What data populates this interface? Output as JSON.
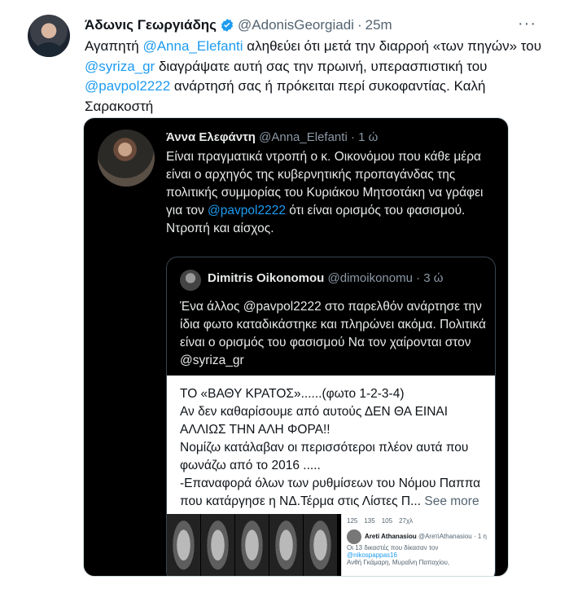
{
  "tweet": {
    "author_name": "Άδωνις Γεωργιάδης",
    "handle": "@AdonisGeorgiadi",
    "separator": "·",
    "time": "25m",
    "more_icon": "more-dots-icon",
    "verified_icon": "verified-badge-icon",
    "body": {
      "t1": "Αγαπητή ",
      "m1": "@Anna_Elefanti",
      "t2": " αληθεύει ότι μετά την διαρροή «των πηγών» του ",
      "m2": "@syriza_gr",
      "t3": " διαγράψατε αυτή σας την πρωινή, υπερασπιστική του ",
      "m3": "@pavpol2222",
      "t4": " ανάρτησή σας ή πρόκειται περί συκοφαντίας. Καλή Σαρακοστή"
    }
  },
  "embed": {
    "author_name": "Άννα Ελεφάντη",
    "handle": "@Anna_Elefanti",
    "separator": "·",
    "time": "1 ώ",
    "text1": "Είναι πραγματικά ντροπή ο κ. Οικονόμου που κάθε μέρα είναι ο αρχηγός της κυβερνητικής προπαγάνδας της πολιτικής συμμορίας του Κυριάκου Μητσοτάκη να γράφει για τον ",
    "mention": "@pavpol2222",
    "text2": " ότι είναι ορισμός του φασισμού.",
    "text3": "Ντροπή και αίσχος.",
    "quote": {
      "author_name": "Dimitris Oikonomou",
      "handle": "@dimoikonomu",
      "separator": "·",
      "time": "3 ώ",
      "text": "Ένα άλλος @pavpol2222 στο παρελθόν ανάρτησε την ίδια φωτο καταδικάστηκε και πληρώνει ακόμα. Πολιτικά είναι ο ορισμός του φασισμού Να τον χαίρονται στον @syriza_gr",
      "card_lines": [
        "ΤΟ «ΒΑΘΥ ΚΡΑΤΟΣ»......(φωτο 1-2-3-4)",
        "Αν δεν καθαρίσουμε από αυτούς ΔΕΝ ΘΑ ΕΙΝΑΙ",
        "ΑΛΛΙΩΣ ΤΗΝ ΑΛΗ ΦΟΡΑ!!",
        "Νομίζω κατάλαβαν οι περισσότεροι πλέον αυτά που",
        "φωνάζω από το 2016 .....",
        "-Επαναφορά όλων των ρυθμίσεων του Νόμου Παππα",
        "που κατάργησε η ΝΔ.Τέρμα στις Λίστες Π..."
      ],
      "see_more": "See more",
      "mini": {
        "stats": [
          "125",
          "135",
          "105",
          "27χλ"
        ],
        "name": "Areti Athanasiou",
        "handle": "@ArетiAthanasiou · 1 η",
        "line1": "Οι 13 δικαστές που δίκασαν τον",
        "link": "@nikospappas16",
        "line2": "Ανθή Γκάμαρη, Μυραΐνη Παπαχίου,"
      }
    }
  }
}
